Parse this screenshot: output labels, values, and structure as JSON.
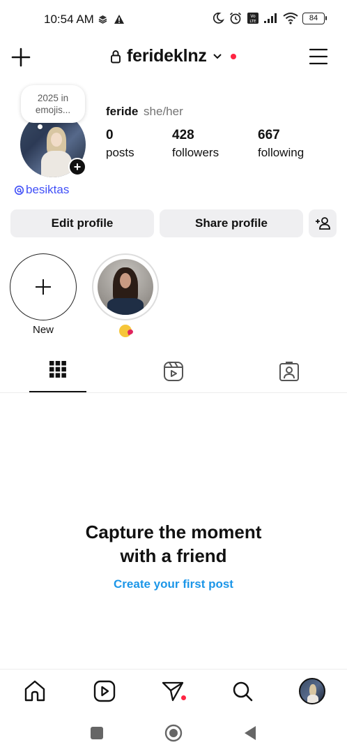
{
  "status_bar": {
    "time": "10:54 AM",
    "battery": "84"
  },
  "header": {
    "username": "ferideklnz"
  },
  "note": {
    "text_line1": "2025 in",
    "text_line2": "emojis..."
  },
  "profile": {
    "name": "feride",
    "pronouns": "she/her",
    "posts_count": "0",
    "posts_label": "posts",
    "followers_count": "428",
    "followers_label": "followers",
    "following_count": "667",
    "following_label": "following",
    "threads_handle": "besiktas"
  },
  "actions": {
    "edit_profile": "Edit profile",
    "share_profile": "Share profile"
  },
  "highlights": [
    {
      "label": "New"
    }
  ],
  "empty_state": {
    "title_line1": "Capture the moment",
    "title_line2": "with a friend",
    "cta": "Create your first post"
  },
  "colors": {
    "accent_link": "#1c96e8",
    "threads_link": "#4150f7",
    "notification_dot": "#ff2442",
    "button_bg": "#efeff1"
  },
  "icons": {
    "create": "plus-icon",
    "lock": "lock-icon",
    "menu": "hamburger-menu-icon",
    "grid_tab": "grid-icon",
    "reels_tab": "reels-icon",
    "tagged_tab": "tagged-person-icon",
    "home": "home-icon",
    "reels": "reels-play-icon",
    "messages": "paper-plane-icon",
    "search": "search-icon"
  }
}
